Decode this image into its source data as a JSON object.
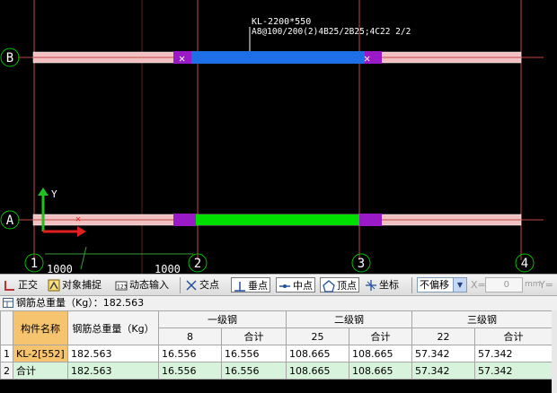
{
  "canvas": {
    "beam_label_line1": "KL-2200*550",
    "beam_label_line2": "A8@100/200(2)4B25/2B25;4C22 2/2",
    "axis_rows": [
      "B",
      "A"
    ],
    "axis_cols": [
      "1",
      "2",
      "3",
      "4"
    ],
    "dimensions": [
      "1000",
      "1000"
    ],
    "ucs_y_label": "Y",
    "colors": {
      "background": "#000000",
      "axis_line": "#c0484a",
      "beam_outline": "#f2c0c0",
      "beam_selected": "#1e6ee8",
      "beam_reinforced": "#00e000",
      "support": "#9a1ac8",
      "ucs_x": "#e02020",
      "ucs_y": "#20c020",
      "axis_bubble": "#00c000"
    }
  },
  "toolbar": {
    "ortho": "正交",
    "object_snap": "对象捕捉",
    "dynamic_input": "动态输入",
    "intersection": "交点",
    "perpendicular": "垂点",
    "midpoint": "中点",
    "vertex": "顶点",
    "coordinate": "坐标",
    "offset_mode": "不偏移",
    "x_label": "X=",
    "x_value": "0",
    "x_unit": "mm",
    "y_label": "Y="
  },
  "summary": {
    "label": "钢筋总重量（Kg）：182.563"
  },
  "table": {
    "headers": {
      "member_name": "构件名称",
      "total_weight": "钢筋总重量（Kg）",
      "grade1": "一级钢",
      "grade2": "二级钢",
      "grade3": "三级钢",
      "g1_dia": "8",
      "g1_total": "合计",
      "g2_dia": "25",
      "g2_total": "合计",
      "g3_dia": "22",
      "g3_total": "合计"
    },
    "rows": [
      {
        "num": "1",
        "name": "KL-2[552]",
        "total": "182.563",
        "g1_8": "16.556",
        "g1_sum": "16.556",
        "g2_25": "108.665",
        "g2_sum": "108.665",
        "g3_22": "57.342",
        "g3_sum": "57.342"
      },
      {
        "num": "2",
        "name": "合计",
        "total": "182.563",
        "g1_8": "16.556",
        "g1_sum": "16.556",
        "g2_25": "108.665",
        "g2_sum": "108.665",
        "g3_22": "57.342",
        "g3_sum": "57.342"
      }
    ]
  }
}
